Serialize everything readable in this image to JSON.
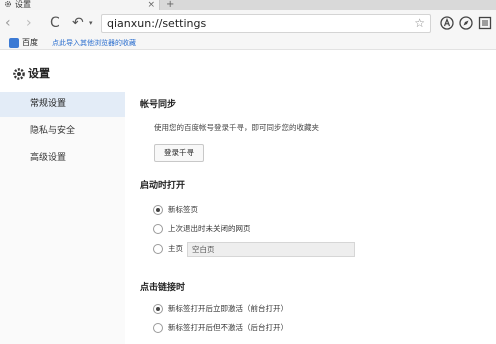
{
  "tab": {
    "title": "设置",
    "close": "×",
    "new_tab": "+"
  },
  "toolbar": {
    "back": "‹",
    "forward": "›",
    "reload": "C",
    "undo": "↶",
    "undo_arrow": "▾",
    "url": "qianxun://settings",
    "star": "☆"
  },
  "bookmarks": {
    "label": "百度",
    "import": "点此导入其他浏览器的收藏"
  },
  "header": {
    "title": "设置"
  },
  "sidebar": {
    "items": [
      {
        "label": "常规设置",
        "active": true
      },
      {
        "label": "隐私与安全",
        "active": false
      },
      {
        "label": "高级设置",
        "active": false
      }
    ]
  },
  "account": {
    "title": "帐号同步",
    "description": "使用您的百度帐号登录千寻，即可同步您的收藏夹",
    "login_button": "登录千寻"
  },
  "startup": {
    "title": "启动时打开",
    "options": [
      {
        "label": "新标签页",
        "checked": true
      },
      {
        "label": "上次退出时未关闭的网页",
        "checked": false
      },
      {
        "label": "主页",
        "checked": false
      }
    ],
    "homepage_value": "空白页"
  },
  "link_click": {
    "title": "点击链接时",
    "options": [
      {
        "label": "新标签打开后立即激活（前台打开）",
        "checked": true
      },
      {
        "label": "新标签打开后但不激活（后台打开）",
        "checked": false
      }
    ]
  },
  "colors": {
    "accent": "#3c7ad4",
    "sidebar_active": "#e3ecf7"
  }
}
